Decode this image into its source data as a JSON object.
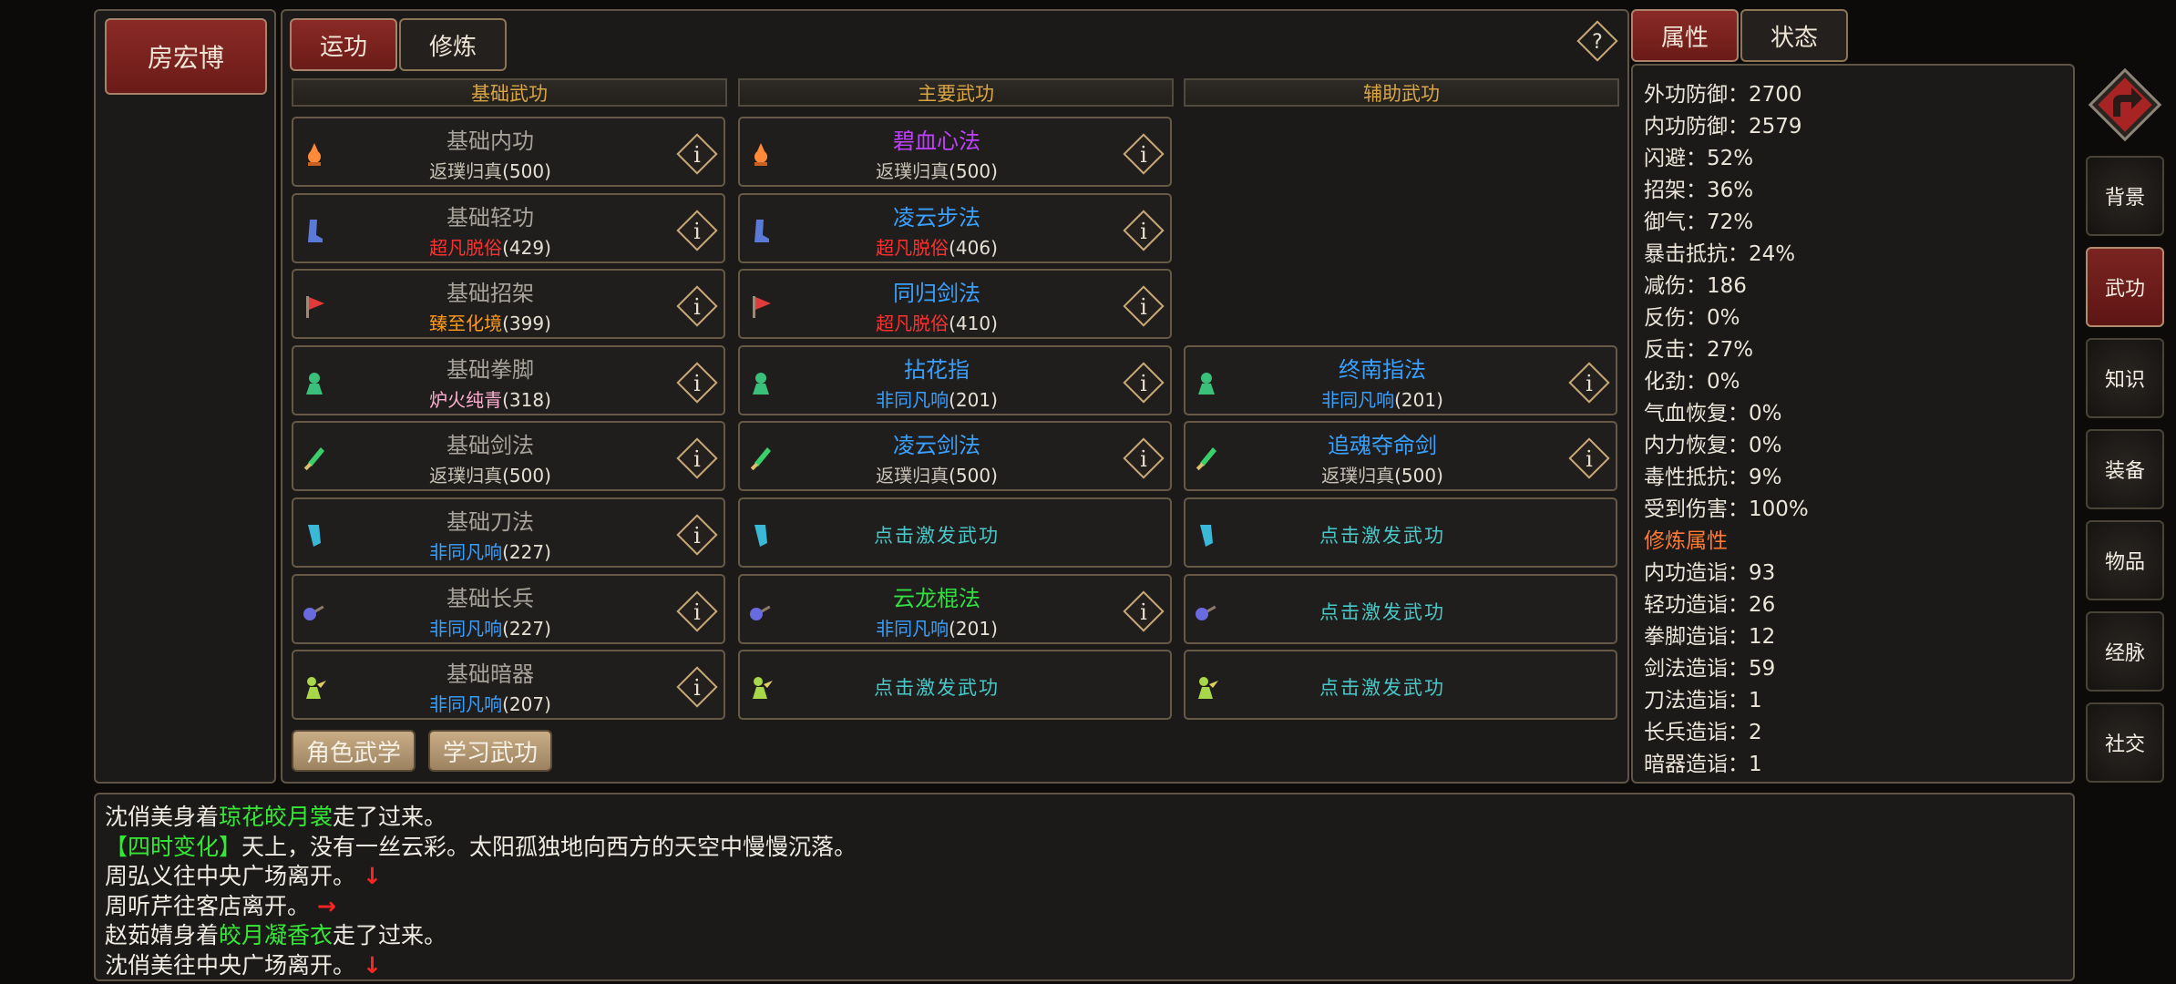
{
  "character": {
    "name": "房宏博"
  },
  "tabs": [
    {
      "label": "运功",
      "active": true
    },
    {
      "label": "修炼",
      "active": false
    }
  ],
  "help_symbol": "?",
  "right_tabs": [
    {
      "label": "属性",
      "active": true
    },
    {
      "label": "状态",
      "active": false
    }
  ],
  "columns": {
    "basic": "基础武功",
    "main": "主要武功",
    "aux": "辅助武功"
  },
  "trigger_label": "点击激发武功",
  "info_symbol": "i",
  "basic_skills": [
    {
      "name": "基础内功",
      "level": "返璞归真",
      "value": "(500)",
      "level_color": "#c8c2b6",
      "icon": "flame-icon"
    },
    {
      "name": "基础轻功",
      "level": "超凡脱俗",
      "value": "(429)",
      "level_color": "#ff3030",
      "icon": "boot-icon"
    },
    {
      "name": "基础招架",
      "level": "臻至化境",
      "value": "(399)",
      "level_color": "#ff9a1a",
      "icon": "flag-icon"
    },
    {
      "name": "基础拳脚",
      "level": "炉火纯青",
      "value": "(318)",
      "level_color": "#ffb0d0",
      "icon": "fist-icon"
    },
    {
      "name": "基础剑法",
      "level": "返璞归真",
      "value": "(500)",
      "level_color": "#c8c2b6",
      "icon": "sword-icon"
    },
    {
      "name": "基础刀法",
      "level": "非同凡响",
      "value": "(227)",
      "level_color": "#3aa0ff",
      "icon": "blade-icon"
    },
    {
      "name": "基础长兵",
      "level": "非同凡响",
      "value": "(227)",
      "level_color": "#3aa0ff",
      "icon": "spear-icon"
    },
    {
      "name": "基础暗器",
      "level": "非同凡响",
      "value": "(207)",
      "level_color": "#3aa0ff",
      "icon": "dart-icon"
    }
  ],
  "main_skills": [
    {
      "name": "碧血心法",
      "name_color": "#c040ff",
      "level": "返璞归真",
      "value": "(500)",
      "level_color": "#c8c2b6",
      "icon": "flame-icon"
    },
    {
      "name": "凌云步法",
      "name_color": "#3aa0ff",
      "level": "超凡脱俗",
      "value": "(406)",
      "level_color": "#ff3030",
      "icon": "boot-icon"
    },
    {
      "name": "同归剑法",
      "name_color": "#3aa0ff",
      "level": "超凡脱俗",
      "value": "(410)",
      "level_color": "#ff3030",
      "icon": "flag-icon"
    },
    {
      "name": "拈花指",
      "name_color": "#3aa0ff",
      "level": "非同凡响",
      "value": "(201)",
      "level_color": "#3aa0ff",
      "icon": "fist-icon"
    },
    {
      "name": "凌云剑法",
      "name_color": "#3aa0ff",
      "level": "返璞归真",
      "value": "(500)",
      "level_color": "#c8c2b6",
      "icon": "sword-icon"
    },
    {
      "empty": true,
      "icon": "blade-icon"
    },
    {
      "name": "云龙棍法",
      "name_color": "#30e040",
      "level": "非同凡响",
      "value": "(201)",
      "level_color": "#3aa0ff",
      "icon": "spear-icon"
    },
    {
      "empty": true,
      "icon": "dart-icon"
    }
  ],
  "aux_skills": [
    null,
    null,
    null,
    {
      "name": "终南指法",
      "name_color": "#3aa0ff",
      "level": "非同凡响",
      "value": "(201)",
      "level_color": "#3aa0ff",
      "icon": "fist-icon"
    },
    {
      "name": "追魂夺命剑",
      "name_color": "#3aa0ff",
      "level": "返璞归真",
      "value": "(500)",
      "level_color": "#c8c2b6",
      "icon": "sword-icon"
    },
    {
      "empty": true,
      "icon": "blade-icon"
    },
    {
      "empty": true,
      "icon": "spear-icon"
    },
    {
      "empty": true,
      "icon": "dart-icon"
    }
  ],
  "bottom_buttons": [
    "角色武学",
    "学习武功"
  ],
  "stats": [
    "外功防御：2700",
    "内功防御：2579",
    "闪避：52%",
    "招架：36%",
    "御气：72%",
    "暴击抵抗：24%",
    "减伤：186",
    "反伤：0%",
    "反击：27%",
    "化劲：0%",
    "气血恢复：0%",
    "内力恢复：0%",
    "毒性抵抗：9%",
    "受到伤害：100%"
  ],
  "train_header": "修炼属性",
  "train_stats": [
    "内功造诣：93",
    "轻功造诣：26",
    "拳脚造诣：12",
    "剑法造诣：59",
    "刀法造诣：1",
    "长兵造诣：2",
    "暗器造诣：1"
  ],
  "side_nav": [
    {
      "label": "背景",
      "active": false
    },
    {
      "label": "武功",
      "active": true
    },
    {
      "label": "知识",
      "active": false
    },
    {
      "label": "装备",
      "active": false
    },
    {
      "label": "物品",
      "active": false
    },
    {
      "label": "经脉",
      "active": false
    },
    {
      "label": "社交",
      "active": false
    }
  ],
  "log": [
    {
      "parts": [
        {
          "t": "沈俏美身着",
          "c": "#f0ece4"
        },
        {
          "t": "琼花皎月裳",
          "c": "#36e836"
        },
        {
          "t": "走了过来。",
          "c": "#f0ece4"
        }
      ]
    },
    {
      "parts": [
        {
          "t": "【四时变化】",
          "c": "#36e836"
        },
        {
          "t": "天上，没有一丝云彩。太阳孤独地向西方的天空中慢慢沉落。",
          "c": "#f0ece4"
        }
      ]
    },
    {
      "parts": [
        {
          "t": "周弘义往中央广场离开。",
          "c": "#f0ece4"
        }
      ],
      "arrow": "↓"
    },
    {
      "parts": [
        {
          "t": "周听芹往客店离开。",
          "c": "#f0ece4"
        }
      ],
      "arrow": "→"
    },
    {
      "parts": [
        {
          "t": "赵茹婧身着",
          "c": "#f0ece4"
        },
        {
          "t": "皎月凝香衣",
          "c": "#36e836"
        },
        {
          "t": "走了过来。",
          "c": "#f0ece4"
        }
      ]
    },
    {
      "parts": [
        {
          "t": "沈俏美往中央广场离开。",
          "c": "#f0ece4"
        }
      ],
      "arrow": "↓"
    }
  ],
  "icon_colors": {
    "flame-icon": "#ff8a3a",
    "boot-icon": "#5a7ad8",
    "flag-icon": "#e03a3a",
    "fist-icon": "#3ac07a",
    "sword-icon": "#3acf6a",
    "blade-icon": "#3ab8d8",
    "spear-icon": "#6a6ae0",
    "dart-icon": "#a8d84a"
  }
}
